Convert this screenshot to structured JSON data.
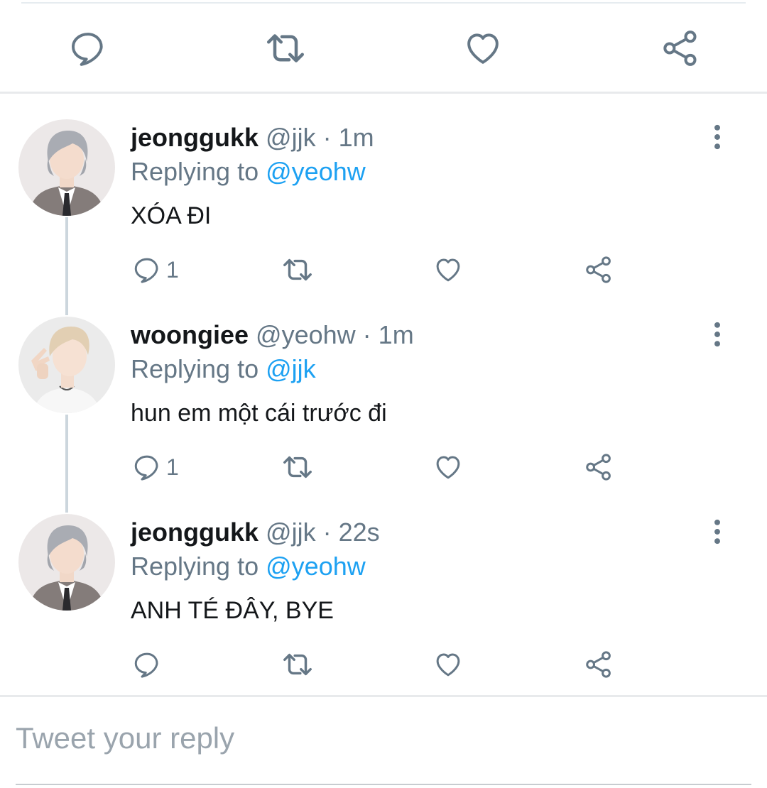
{
  "tweets": [
    {
      "name": "jeonggukk",
      "handle": "@jjk",
      "time": "1m",
      "replying_prefix": "Replying to",
      "replying_to": "@yeohw",
      "text": "XÓA ĐI",
      "reply_count": "1",
      "avatar": "avatar-silver-hair-gray-suit"
    },
    {
      "name": "woongiee",
      "handle": "@yeohw",
      "time": "1m",
      "replying_prefix": "Replying to",
      "replying_to": "@jjk",
      "text": "hun em một cái trước đi",
      "reply_count": "1",
      "avatar": "avatar-blonde-peace-sign"
    },
    {
      "name": "jeonggukk",
      "handle": "@jjk",
      "time": "22s",
      "replying_prefix": "Replying to",
      "replying_to": "@yeohw",
      "text": "ANH TÉ ĐÂY, BYE",
      "reply_count": "",
      "avatar": "avatar-silver-hair-gray-suit"
    }
  ],
  "compose": {
    "placeholder": "Tweet your reply"
  },
  "icons": [
    "reply-icon",
    "retweet-icon",
    "like-icon",
    "share-icon",
    "more-icon"
  ],
  "colors": {
    "text": "#14171a",
    "secondary": "#657786",
    "link": "#1da1f2",
    "divider": "#e8eaec"
  }
}
